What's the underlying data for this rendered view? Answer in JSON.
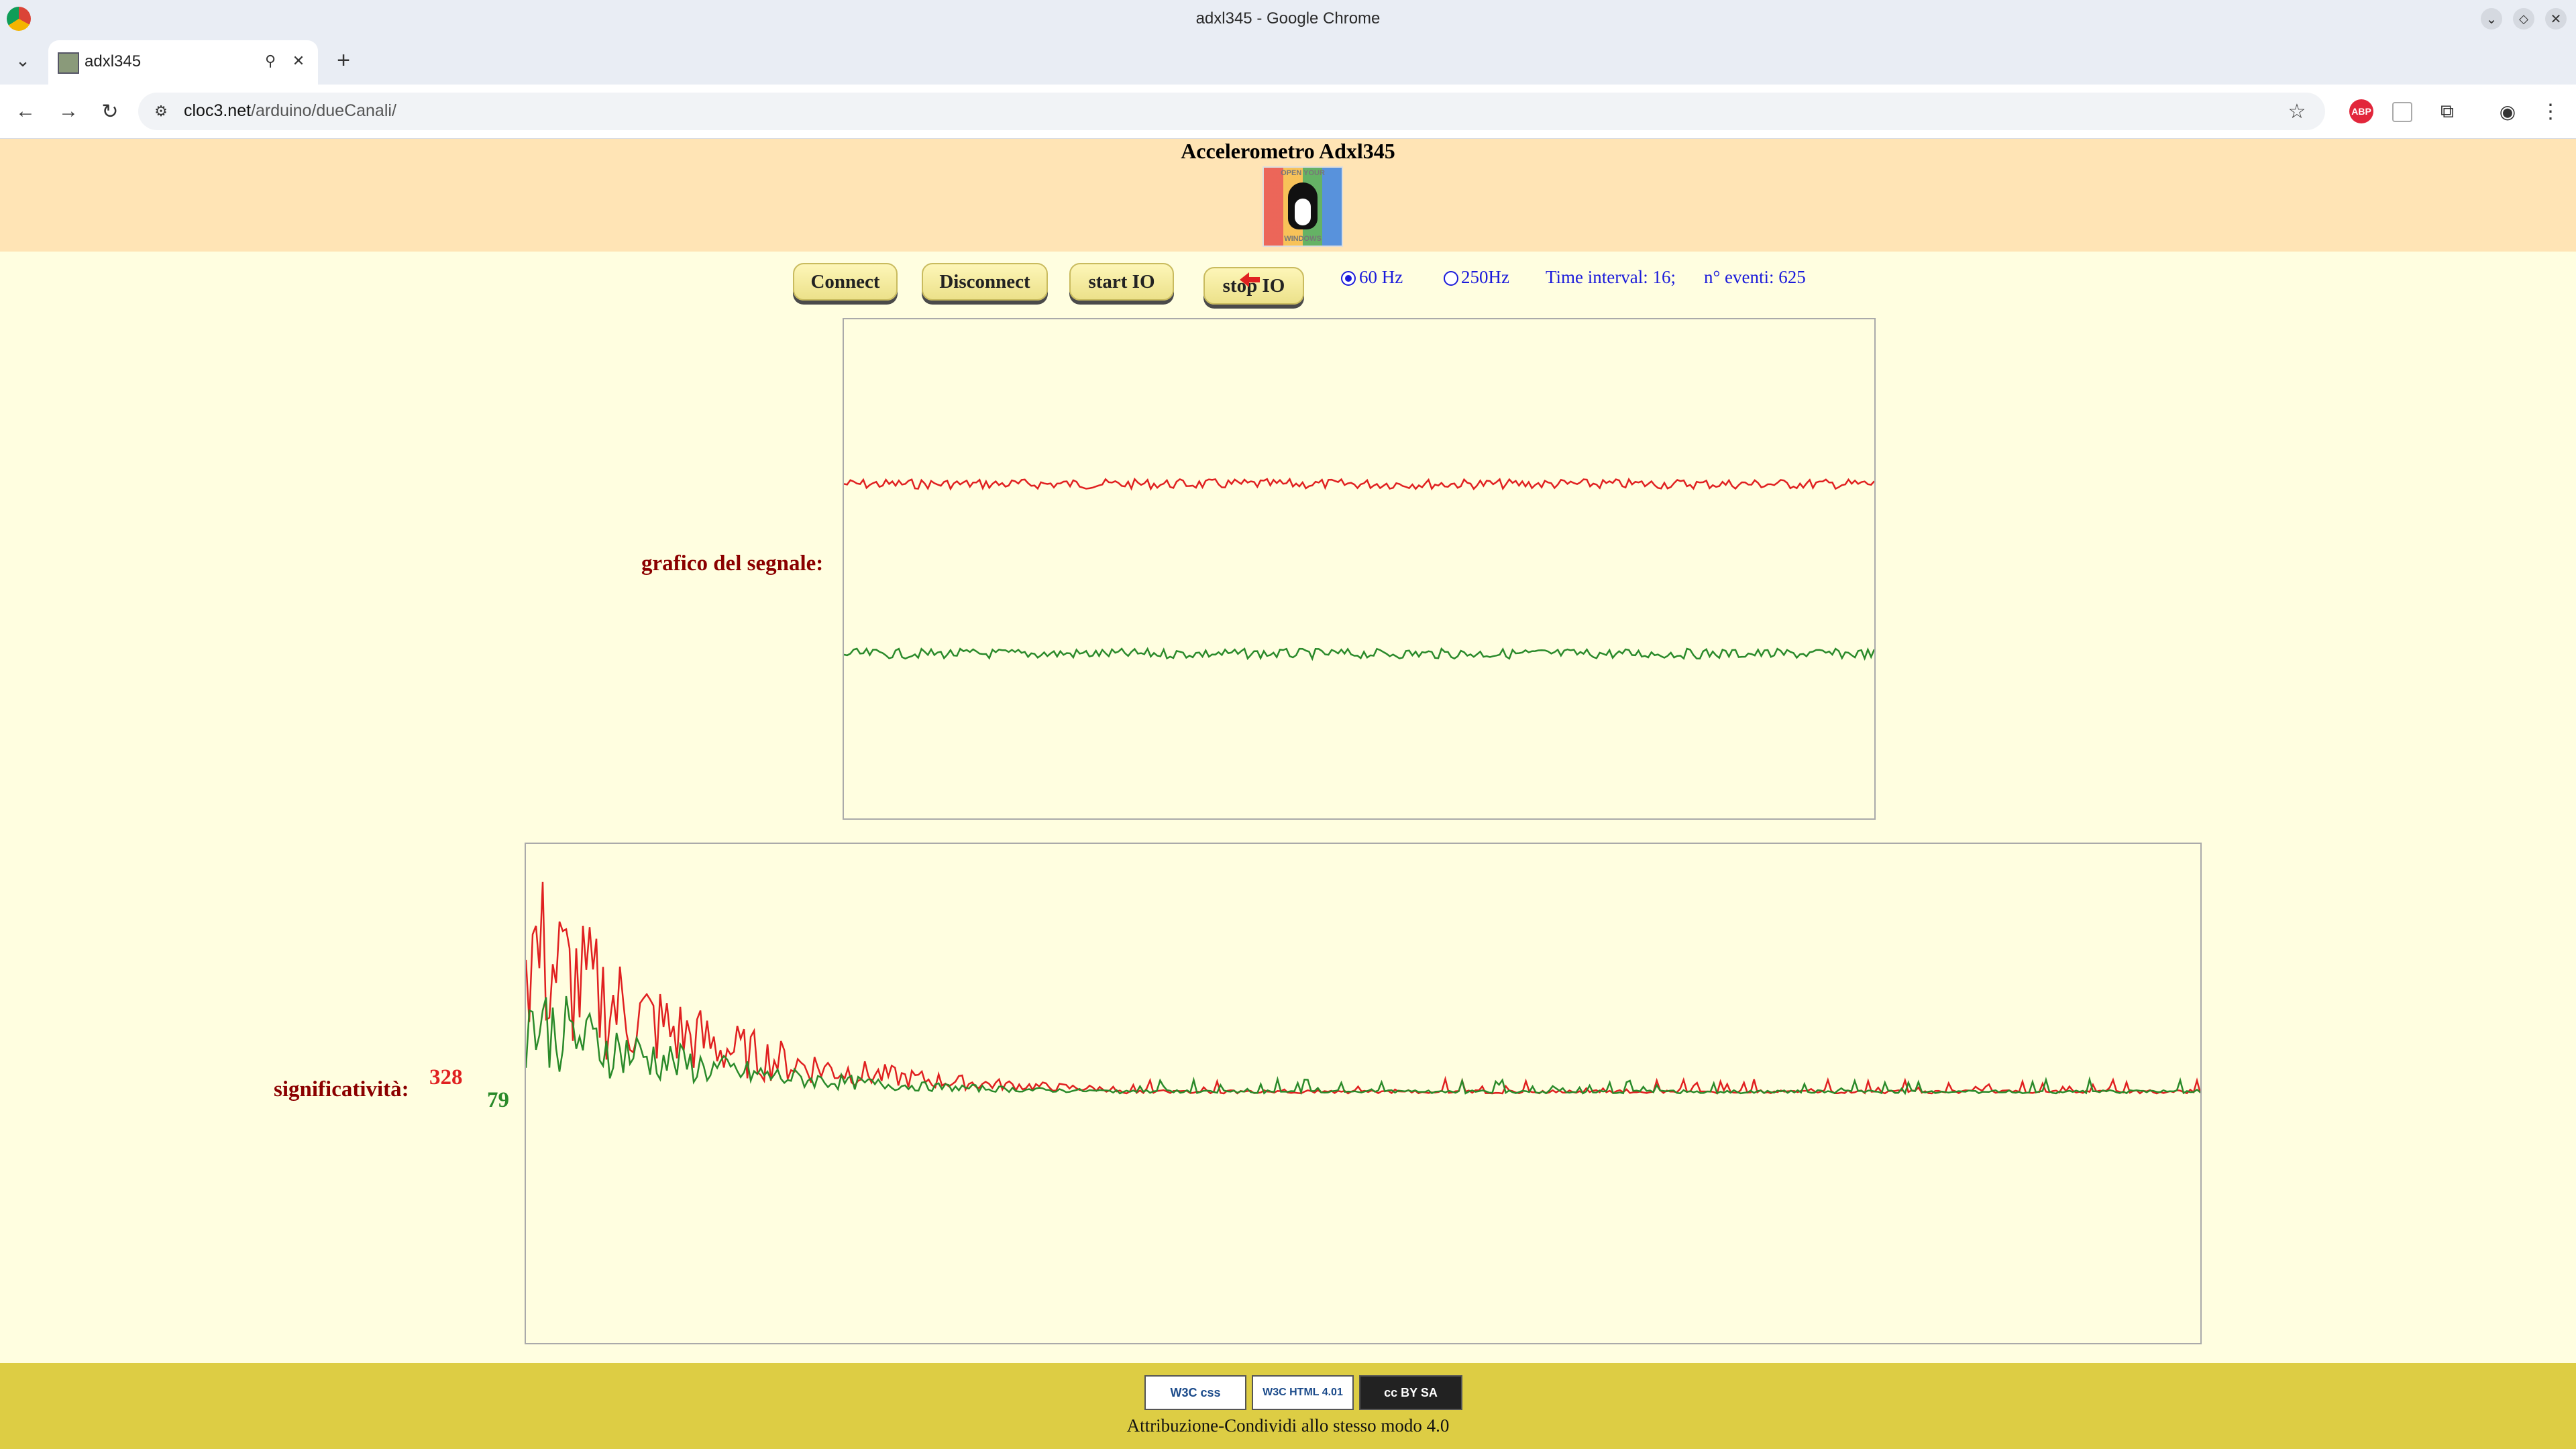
{
  "window": {
    "title": "adxl345 - Google Chrome"
  },
  "tab": {
    "title": "adxl345"
  },
  "address": {
    "domain": "cloc3.net",
    "path": "/arduino/dueCanali/"
  },
  "page": {
    "title": "Accelerometro Adxl345",
    "logo_text_top": "OPEN YOUR",
    "logo_text_bottom": "WINDOWS"
  },
  "controls": {
    "connect": "Connect",
    "disconnect": "Disconnect",
    "start": "start IO",
    "stop": "stop IO",
    "rate_60": "60 Hz",
    "rate_250": "250Hz",
    "rate_selected": "60 Hz",
    "time_interval": "Time interval: 16;",
    "events": "n° eventi: 625"
  },
  "signal": {
    "label": "grafico del segnale:"
  },
  "significance": {
    "label": "significatività:",
    "red_value": "328",
    "green_value": "79"
  },
  "footer": {
    "badge_css": "W3C css",
    "badge_html": "W3C HTML 4.01",
    "badge_cc": "cc BY SA",
    "license": "Attribuzione-Condividi allo stesso modo 4.0"
  },
  "colors": {
    "red_series": "#e02020",
    "green_series": "#2a8a2a",
    "header_bg": "#ffe4b5",
    "page_bg": "#fffee0",
    "footer_bg": "#ddcd44"
  },
  "chart_data": [
    {
      "type": "line",
      "title": "",
      "series": [
        {
          "color": "#e02020",
          "level": 0.67,
          "noise": 0.01
        },
        {
          "color": "#2a8a2a",
          "level": 0.33,
          "noise": 0.01
        }
      ],
      "points": 320
    },
    {
      "type": "line",
      "title": "",
      "series": [
        {
          "color": "#e02020",
          "peak": 1.0,
          "decay": 0.12
        },
        {
          "color": "#2a8a2a",
          "peak": 0.5,
          "decay": 0.12
        }
      ],
      "points": 500
    }
  ]
}
